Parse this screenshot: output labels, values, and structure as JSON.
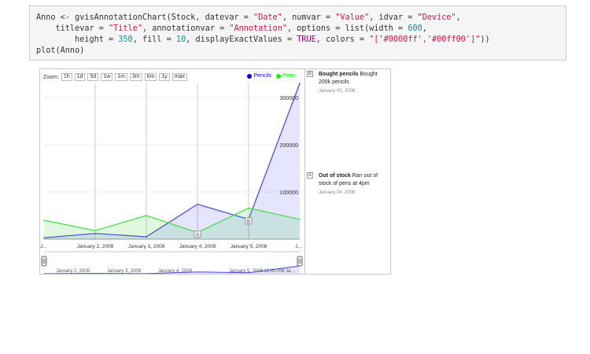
{
  "code": {
    "line1": [
      {
        "t": "Anno <- gvisAnnotationChart(Stock, datevar = ",
        "c": ""
      },
      {
        "t": "\"Date\"",
        "c": "tok-str"
      },
      {
        "t": ", numvar = ",
        "c": ""
      },
      {
        "t": "\"Value\"",
        "c": "tok-str"
      },
      {
        "t": ", idvar = ",
        "c": ""
      },
      {
        "t": "\"Device\"",
        "c": "tok-str"
      },
      {
        "t": ",",
        "c": ""
      }
    ],
    "line2": [
      {
        "t": "    titlevar = ",
        "c": ""
      },
      {
        "t": "\"Title\"",
        "c": "tok-str"
      },
      {
        "t": ", annotationvar = ",
        "c": ""
      },
      {
        "t": "\"Annotation\"",
        "c": "tok-str"
      },
      {
        "t": ", options = list(width = ",
        "c": ""
      },
      {
        "t": "600",
        "c": "tok-num"
      },
      {
        "t": ",",
        "c": ""
      }
    ],
    "line3": [
      {
        "t": "        height = ",
        "c": ""
      },
      {
        "t": "350",
        "c": "tok-num"
      },
      {
        "t": ", fill = ",
        "c": ""
      },
      {
        "t": "10",
        "c": "tok-num"
      },
      {
        "t": ", displayExactValues = ",
        "c": ""
      },
      {
        "t": "TRUE",
        "c": "tok-const"
      },
      {
        "t": ", colors = ",
        "c": ""
      },
      {
        "t": "\"['#0000ff','#00ff00']\"",
        "c": "tok-str"
      },
      {
        "t": "))",
        "c": ""
      }
    ],
    "line4": [
      {
        "t": "plot(Anno)",
        "c": ""
      }
    ]
  },
  "zoom": {
    "label": "Zoom:",
    "buttons": [
      "1h",
      "1d",
      "5d",
      "1w",
      "1m",
      "3m",
      "6m",
      "1y",
      "max"
    ]
  },
  "legend": [
    {
      "name": "Pencils",
      "color": "#0000ff"
    },
    {
      "name": "Pens",
      "color": "#00ff00"
    }
  ],
  "chart_data": {
    "type": "area",
    "x": [
      "January 1, 2008",
      "January 2, 2008",
      "January 3, 2008",
      "January 4, 2008",
      "January 5, 2008",
      "January 6, 2008"
    ],
    "x_tick_labels": [
      "J...",
      "January 2, 2008",
      "January 3, 2008",
      "January 4, 2008",
      "January 5, 2008",
      "J..."
    ],
    "y_tick_labels": [
      "300000",
      "200000",
      "100000"
    ],
    "y_ticks": [
      300000,
      200000,
      100000
    ],
    "ylim": [
      0,
      330000
    ],
    "series": [
      {
        "name": "Pencils",
        "color": "#0000ff",
        "values": [
          3000,
          12000,
          5000,
          74000,
          42000,
          330000
        ]
      },
      {
        "name": "Pens",
        "color": "#00ff00",
        "values": [
          40000,
          18000,
          50000,
          14000,
          66000,
          42000
        ]
      }
    ],
    "annotation_flags": [
      {
        "label": "A",
        "x_index": 3,
        "series": "Pens"
      },
      {
        "label": "B",
        "x_index": 4,
        "series": "Pencils"
      }
    ]
  },
  "range_selector": {
    "labels": [
      "January 2, 2008",
      "January 3, 2008",
      "January 4, 2008",
      "January 5, 2008 12:00 PM",
      "Ja..."
    ]
  },
  "annotations": [
    {
      "flag": "B",
      "title": "Bought pencils",
      "text": "Bought 200k pencils",
      "date": "January 05, 2008"
    },
    {
      "flag": "A",
      "title": "Out of stock",
      "text": "Ran out of stock of pens at 4pm",
      "date": "January 04, 2008"
    }
  ]
}
